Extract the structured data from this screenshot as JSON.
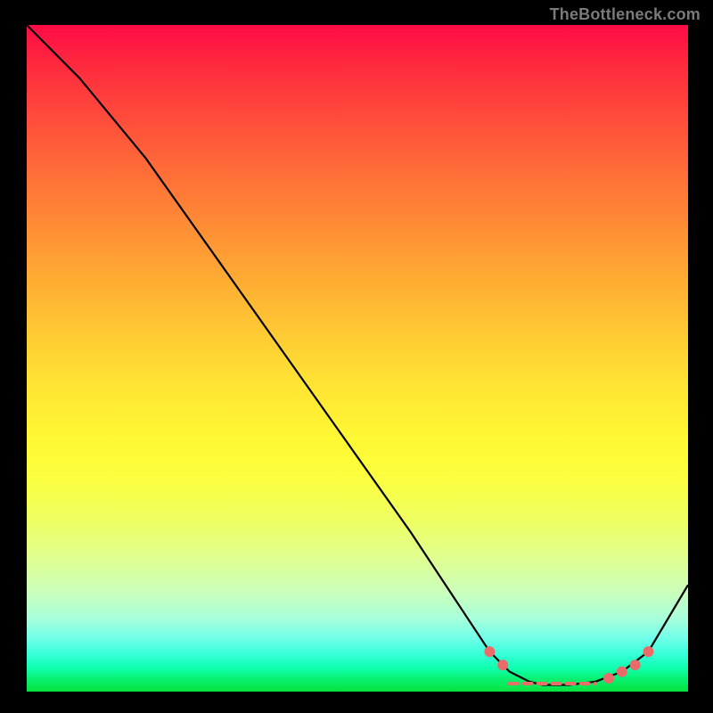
{
  "attribution": "TheBottleneck.com",
  "chart_data": {
    "type": "line",
    "title": "",
    "xlabel": "",
    "ylabel": "",
    "xlim": [
      0,
      100
    ],
    "ylim": [
      0,
      100
    ],
    "series": [
      {
        "name": "black-curve",
        "x": [
          0,
          8,
          18,
          28,
          38,
          48,
          58,
          66,
          70,
          73,
          76,
          78,
          82,
          86,
          90,
          94,
          100
        ],
        "y": [
          100,
          92,
          80,
          66,
          52,
          38,
          24,
          12,
          6,
          3,
          1.5,
          1,
          1,
          1.5,
          3,
          6,
          16
        ]
      }
    ],
    "markers": {
      "name": "highlight-dots",
      "x": [
        70,
        72,
        88,
        90,
        92,
        94
      ],
      "y": [
        6,
        4,
        2,
        3,
        4,
        6
      ]
    },
    "dashed_segment": {
      "name": "valley-floor-dash",
      "x": [
        73,
        86
      ],
      "y": [
        1.2,
        1.2
      ]
    },
    "interpretation": "V-shaped curve with minimum (≈best-fit region) around x≈78–84; pink dots and dashed line mark the low-bottleneck valley floor."
  }
}
